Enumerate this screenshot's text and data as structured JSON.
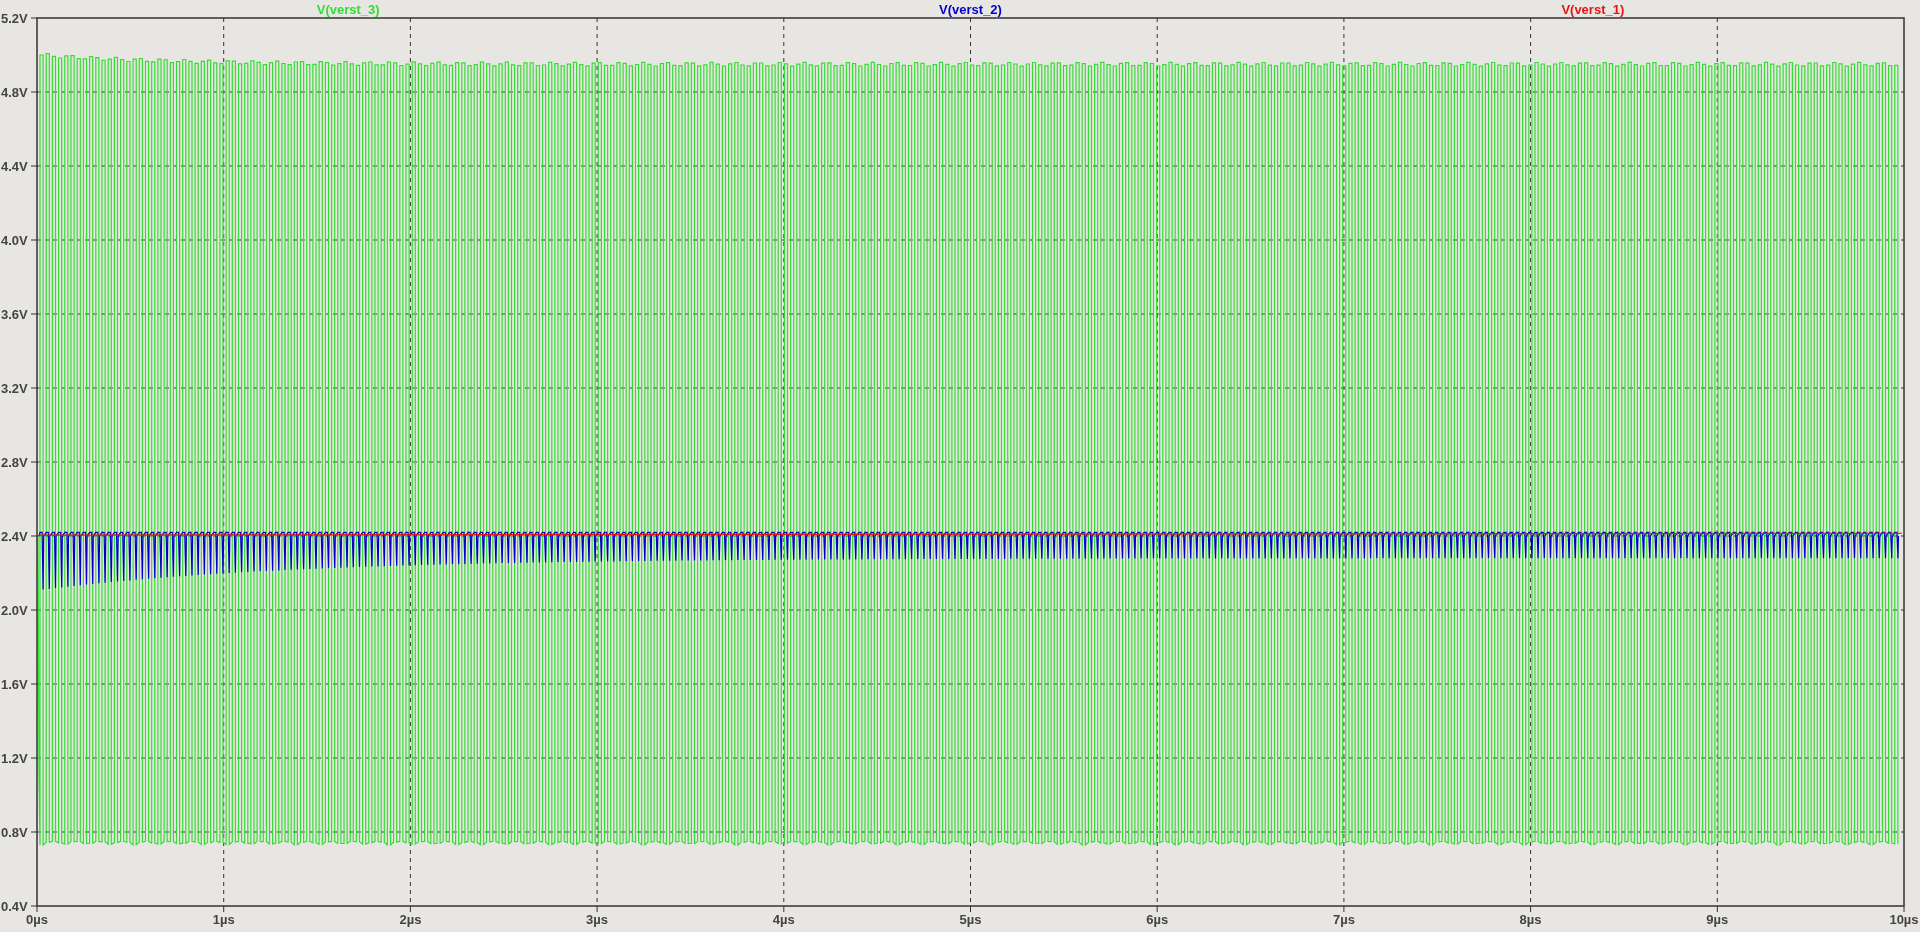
{
  "traces": [
    {
      "label": "V(verst_3)",
      "color": "#33dd33"
    },
    {
      "label": "V(verst_2)",
      "color": "#0000cc"
    },
    {
      "label": "V(verst_1)",
      "color": "#ee1111"
    }
  ],
  "y_axis": {
    "ticks": [
      "5.2V",
      "4.8V",
      "4.4V",
      "4.0V",
      "3.6V",
      "3.2V",
      "2.8V",
      "2.4V",
      "2.0V",
      "1.6V",
      "1.2V",
      "0.8V",
      "0.4V"
    ]
  },
  "x_axis": {
    "ticks": [
      "0µs",
      "1µs",
      "2µs",
      "3µs",
      "4µs",
      "5µs",
      "6µs",
      "7µs",
      "8µs",
      "9µs",
      "10µs"
    ]
  }
}
